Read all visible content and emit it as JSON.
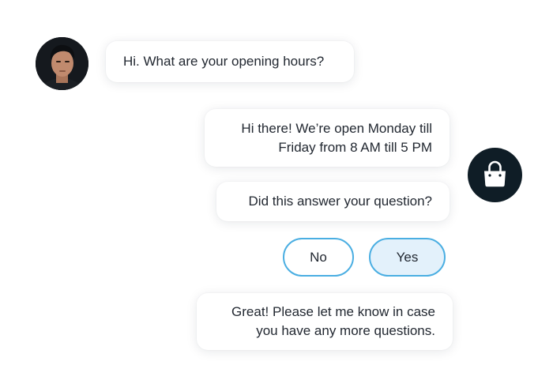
{
  "conversation": {
    "user_message": "Hi. What are your opening hours?",
    "bot_reply_lines": [
      "Hi there! We’re open Monday till",
      "Friday from 8 AM till 5 PM"
    ],
    "bot_question": "Did this answer your question?",
    "quick_replies": {
      "no_label": "No",
      "yes_label": "Yes"
    },
    "bot_followup_lines": [
      "Great! Please let me know in case",
      "you have any more questions."
    ]
  },
  "icons": {
    "user_avatar": "user-avatar-photo",
    "bot_avatar": "shopping-bag-icon"
  },
  "colors": {
    "accent": "#4aaee2",
    "selected_fill": "#e3f1fb",
    "bot_badge": "#0f1d26",
    "text": "#222831"
  }
}
